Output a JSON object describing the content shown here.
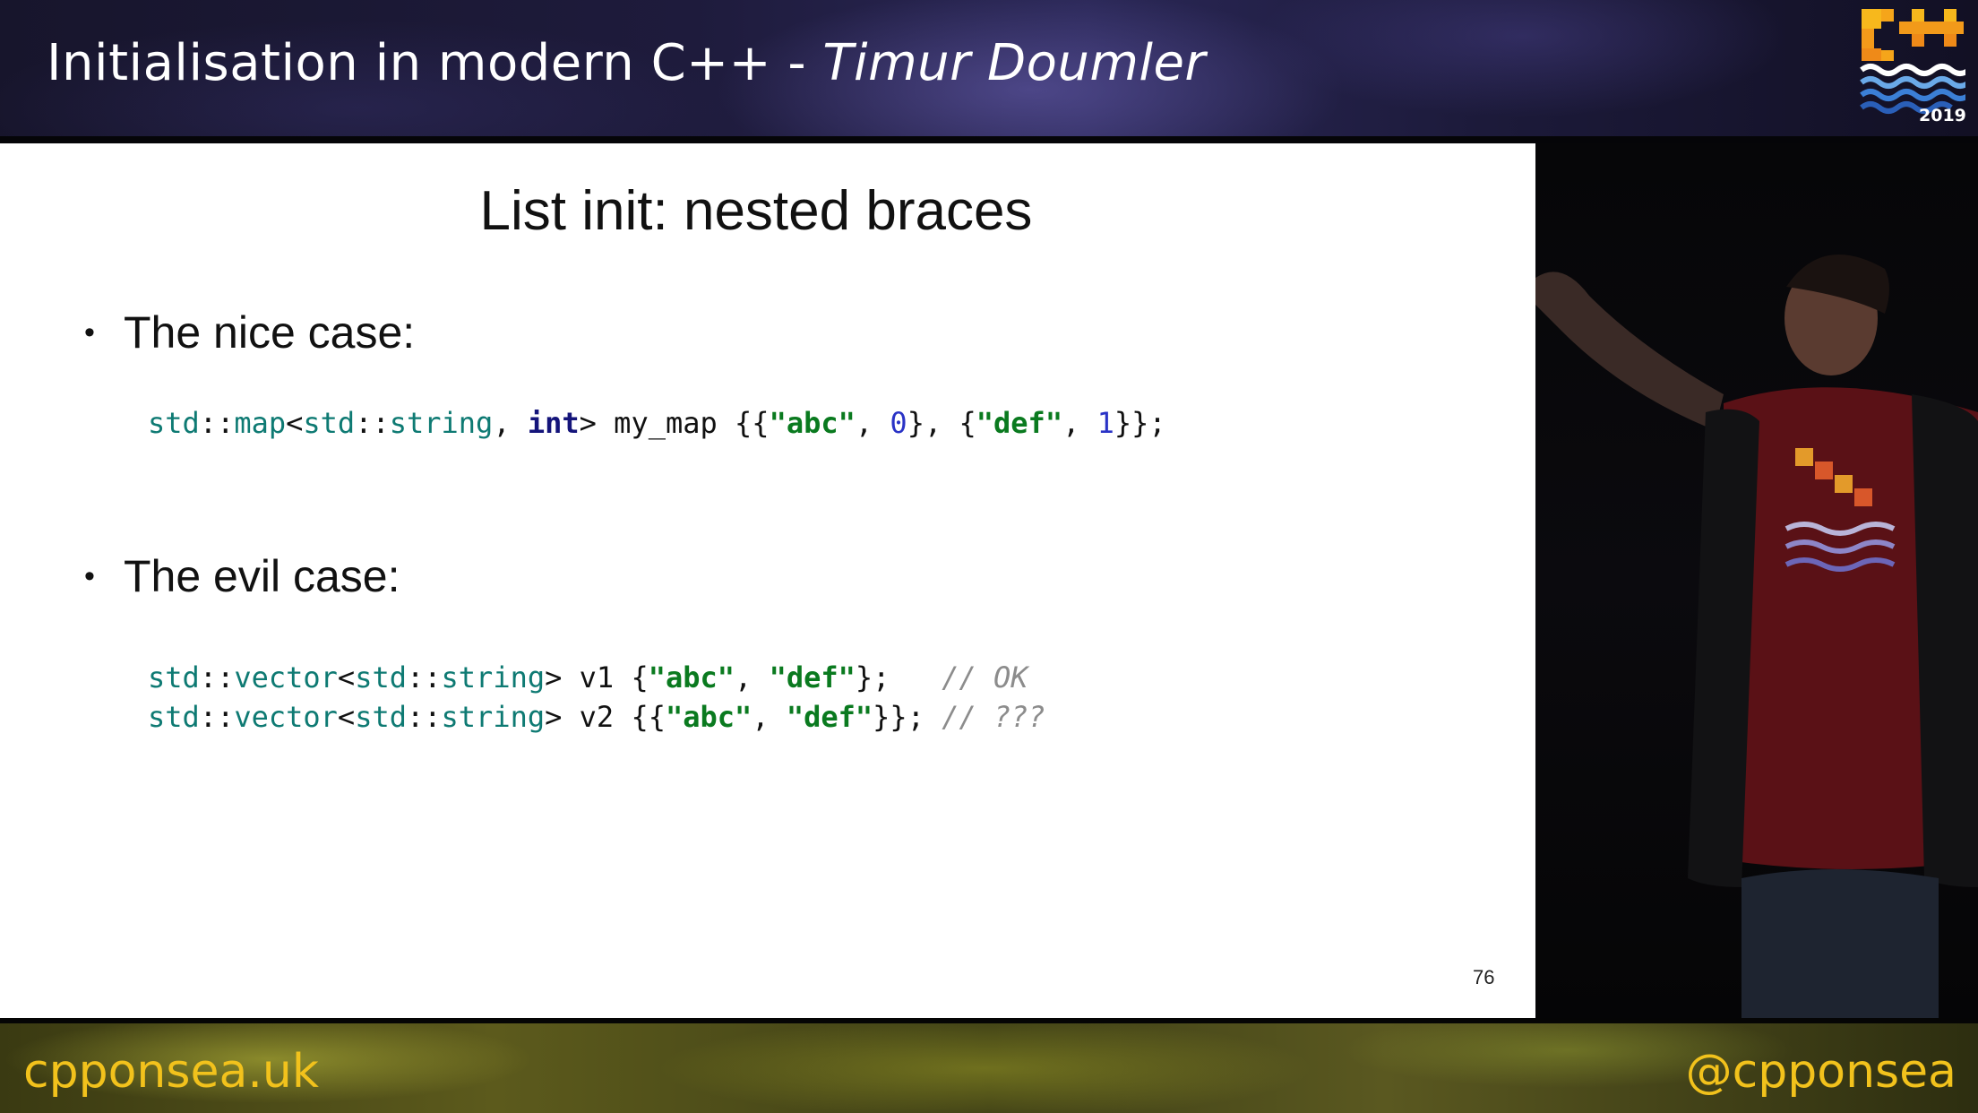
{
  "header": {
    "title_prefix": "Initialisation in modern C++ - ",
    "title_author": "Timur Doumler",
    "logo_year": "2019"
  },
  "slide": {
    "title": "List init: nested braces",
    "bullets": [
      {
        "marker": "•",
        "text": "The nice case:"
      },
      {
        "marker": "•",
        "text": "The evil case:"
      }
    ],
    "code_nice": [
      [
        "std",
        "::",
        "map",
        "<",
        "std",
        "::",
        "string",
        ", ",
        "int",
        "> my_map {{",
        "\"abc\"",
        ", ",
        "0",
        "}, {",
        "\"def\"",
        ", ",
        "1",
        "}};"
      ]
    ],
    "code_evil": {
      "line1": [
        "std",
        "::",
        "vector",
        "<",
        "std",
        "::",
        "string",
        "> v1 {",
        "\"abc\"",
        ", ",
        "\"def\"",
        "};   ",
        "// OK"
      ],
      "line2": [
        "std",
        "::",
        "vector",
        "<",
        "std",
        "::",
        "string",
        "> v2 {{",
        "\"abc\"",
        ", ",
        "\"def\"",
        "}}; ",
        "// ???"
      ]
    },
    "page_number": "76"
  },
  "footer": {
    "left": "cpponsea.uk",
    "right": "@cpponsea"
  },
  "colors": {
    "accent": "#f2c21c",
    "code_type": "#0e7a73",
    "code_keyword": "#14147a",
    "code_string": "#0a7a1f",
    "code_number": "#2a33c6",
    "code_comment": "#8c8c8c"
  }
}
